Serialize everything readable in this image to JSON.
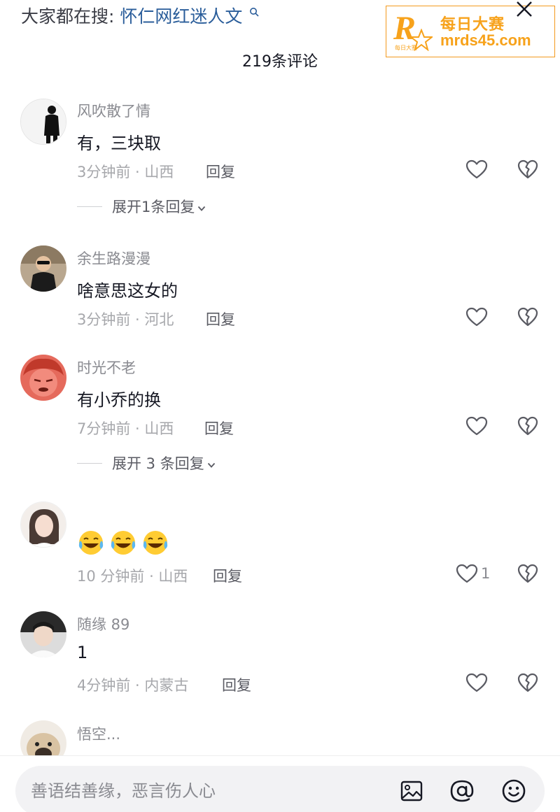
{
  "top": {
    "search_prefix": "大家都在搜:",
    "search_keyword": "怀仁网红迷人文",
    "comment_count_label": "219条评论"
  },
  "watermark": {
    "letter": "R",
    "small_text": "每日大赛",
    "title": "每日大赛",
    "url": "mrds45.com",
    "color": "#f7a21b"
  },
  "comments": [
    {
      "username": "风吹散了情",
      "text": "有，三块取",
      "meta": "3分钟前 · 山西",
      "reply_label": "回复",
      "expand_label": "展开1条回复"
    },
    {
      "username": "余生路漫漫",
      "text": "啥意思这女的",
      "meta": "3分钟前 · 河北",
      "reply_label": "回复"
    },
    {
      "username": "时光不老",
      "text": "有小乔的换",
      "meta": "7分钟前 · 山西",
      "reply_label": "回复",
      "expand_label": "展开 3 条回复"
    },
    {
      "username": "",
      "emoji": [
        "laughing-crying-emoji",
        "laughing-crying-emoji",
        "laughing-crying-emoji"
      ],
      "meta": "10 分钟前 · 山西",
      "reply_label": "回复",
      "like_count": "1"
    },
    {
      "username": "随缘 89",
      "text": "1",
      "meta": "4分钟前 · 内蒙古",
      "reply_label": "回复"
    },
    {
      "username": "悟空..."
    }
  ],
  "input": {
    "placeholder": "善语结善缘，恶言伤人心"
  },
  "icons": {
    "close": "close-icon",
    "like": "heart-outline-icon",
    "dislike": "broken-heart-icon",
    "image": "image-icon",
    "mention": "at-icon",
    "emoji": "smiley-icon"
  }
}
